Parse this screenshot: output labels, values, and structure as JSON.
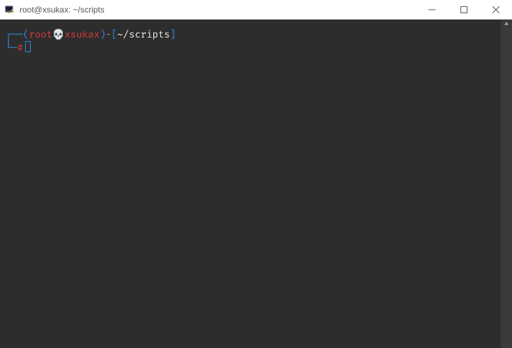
{
  "window": {
    "title": "root@xsukax: ~/scripts"
  },
  "prompt": {
    "line1_prefix": "┌──",
    "paren_open": "(",
    "user": "root",
    "separator_icon": "💀",
    "host": "xsukax",
    "paren_close": ")",
    "dash": "-",
    "bracket_open": "[",
    "path": "~/scripts",
    "bracket_close": "]",
    "line2_prefix": "└─",
    "hash": "#"
  },
  "icons": {
    "app": "putty-icon",
    "minimize": "minimize-icon",
    "maximize": "maximize-icon",
    "close": "close-icon",
    "scroll_up": "scroll-up-arrow"
  },
  "colors": {
    "background": "#2d2d2d",
    "blue": "#2e8be6",
    "red": "#d43a3a",
    "text": "#e8e8e8"
  }
}
